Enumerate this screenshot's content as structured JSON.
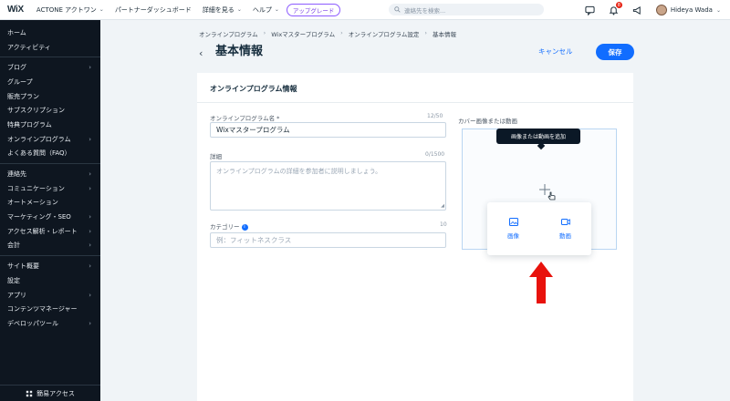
{
  "topbar": {
    "logo": "WiX",
    "site_name": "ACTONE アクトワン",
    "partner_dashboard": "パートナーダッシュボード",
    "details": "詳細を見る",
    "help": "ヘルプ",
    "upgrade": "アップグレード",
    "search_placeholder": "連絡先を検索...",
    "notification_count": "8",
    "user_name": "Hideya Wada"
  },
  "sidebar": {
    "items": [
      {
        "label": "ホーム",
        "arrow": false
      },
      {
        "label": "アクティビティ",
        "arrow": false
      },
      {
        "label": "ブログ",
        "arrow": true
      },
      {
        "label": "グループ",
        "arrow": false
      },
      {
        "label": "販売プラン",
        "arrow": false
      },
      {
        "label": "サブスクリプション",
        "arrow": false
      },
      {
        "label": "特典プログラム",
        "arrow": false
      },
      {
        "label": "オンラインプログラム",
        "arrow": true
      },
      {
        "label": "よくある質問（FAQ）",
        "arrow": false
      },
      {
        "label": "連絡先",
        "arrow": true
      },
      {
        "label": "コミュニケーション",
        "arrow": true
      },
      {
        "label": "オートメーション",
        "arrow": false
      },
      {
        "label": "マーケティング・SEO",
        "arrow": true
      },
      {
        "label": "アクセス解析・レポート",
        "arrow": true
      },
      {
        "label": "会計",
        "arrow": true
      },
      {
        "label": "サイト概要",
        "arrow": true
      },
      {
        "label": "設定",
        "arrow": false
      },
      {
        "label": "アプリ",
        "arrow": true
      },
      {
        "label": "コンテンツマネージャー",
        "arrow": false
      },
      {
        "label": "デベロッパツール",
        "arrow": true
      }
    ],
    "footer": "簡易アクセス"
  },
  "breadcrumb": [
    "オンラインプログラム",
    "Wixマスタープログラム",
    "オンラインプログラム設定",
    "基本情報"
  ],
  "header": {
    "title": "基本情報",
    "cancel": "キャンセル",
    "save": "保存"
  },
  "form": {
    "section_title": "オンラインプログラム情報",
    "name_label": "オンラインプログラム名 *",
    "name_counter": "12/50",
    "name_value": "Wixマスタープログラム",
    "details_label": "詳細",
    "details_counter": "0/1500",
    "details_placeholder": "オンラインプログラムの詳細を参加者に説明しましょう。",
    "category_label": "カテゴリー",
    "category_counter": "10",
    "category_placeholder": "例：フィットネスクラス",
    "cover_label": "カバー画像または動画",
    "tooltip": "画像または動画を追加",
    "popup_image": "画像",
    "popup_video": "動画"
  },
  "colors": {
    "accent": "#116dff",
    "sidebar_bg": "#0e1620",
    "arrow_red": "#e8120c"
  }
}
